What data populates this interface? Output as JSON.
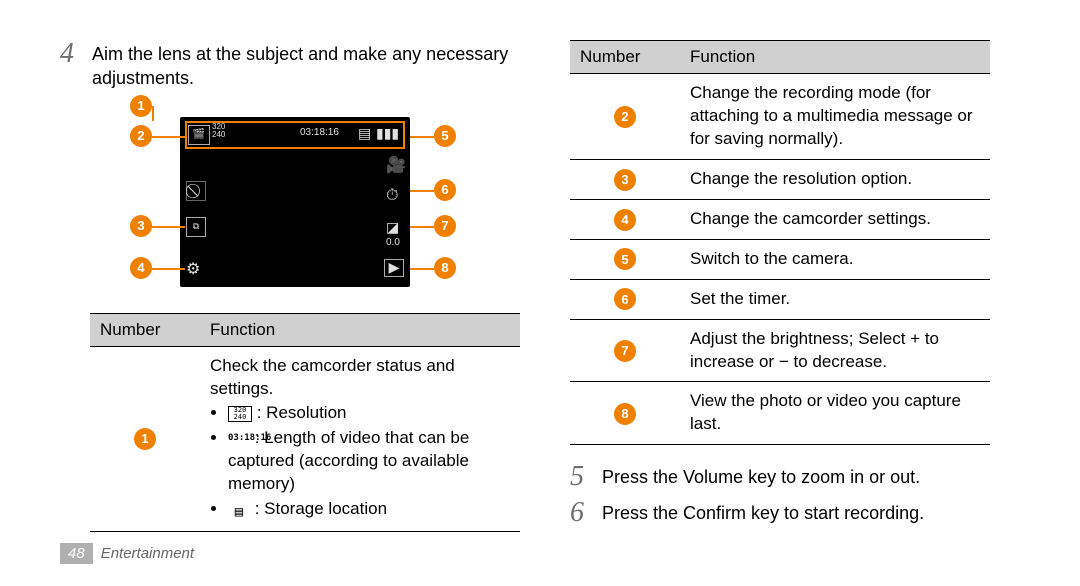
{
  "step4": {
    "num": "4",
    "text": "Aim the lens at the subject and make any necessary adjustments."
  },
  "step5": {
    "num": "5",
    "text": "Press the Volume key to zoom in or out."
  },
  "step6": {
    "num": "6",
    "text": "Press the Confirm key to start recording."
  },
  "screen": {
    "res": "320\n240",
    "time": "03:18:16",
    "ev": "0.0"
  },
  "table_left": {
    "head_num": "Number",
    "head_func": "Function",
    "row1_intro": "Check the camcorder status and settings.",
    "row1_b1": " : Resolution",
    "row1_b1_icon": "320\n240",
    "row1_b2_icon": "03:18:16",
    "row1_b2": " : Length of video that can be captured (according to available memory)",
    "row1_b3": " : Storage location",
    "row1_b3_icon": "▤"
  },
  "table_right": {
    "head_num": "Number",
    "head_func": "Function",
    "r2": "Change the recording mode (for attaching to a multimedia message or for saving normally).",
    "r3": "Change the resolution option.",
    "r4": "Change the camcorder settings.",
    "r5": "Switch to the camera.",
    "r6": "Set the timer.",
    "r7": "Adjust the brightness; Select + to increase or − to decrease.",
    "r8": "View the photo or video you capture last."
  },
  "footer": {
    "page": "48",
    "section": "Entertainment"
  }
}
